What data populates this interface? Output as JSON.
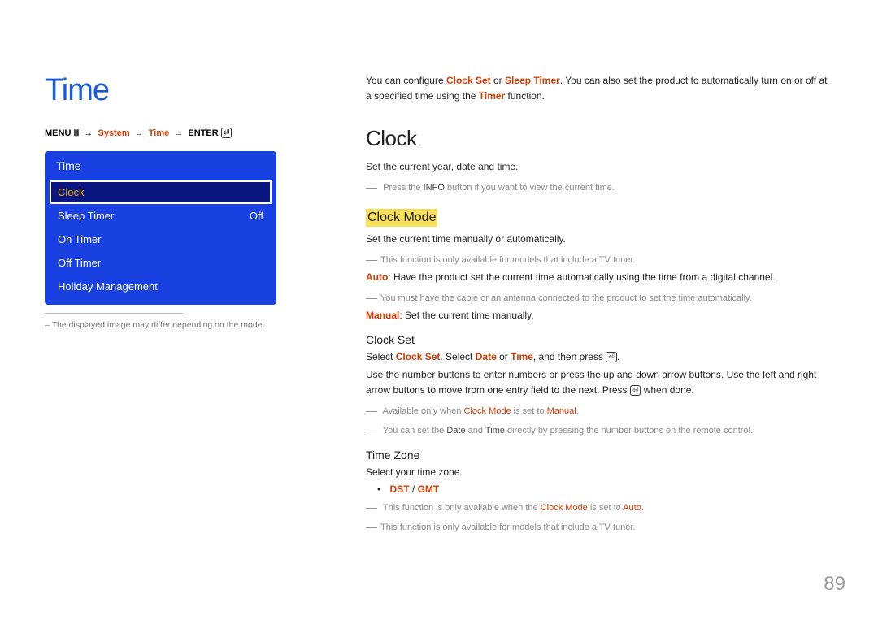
{
  "page": {
    "title": "Time",
    "number": "89"
  },
  "breadcrumb": {
    "menu_label": "MENU",
    "arrow": "→",
    "system": "System",
    "time": "Time",
    "enter": "ENTER"
  },
  "menu_card": {
    "title": "Time",
    "items": [
      {
        "label": "Clock",
        "value": "",
        "selected": true
      },
      {
        "label": "Sleep Timer",
        "value": "Off"
      },
      {
        "label": "On Timer",
        "value": ""
      },
      {
        "label": "Off Timer",
        "value": ""
      },
      {
        "label": "Holiday Management",
        "value": ""
      }
    ]
  },
  "footnote": "– The displayed image may differ depending on the model.",
  "intro": {
    "prefix": "You can configure ",
    "clock_set": "Clock Set",
    "or": " or ",
    "sleep_timer": "Sleep Timer",
    "after": ". You can also set the product to automatically turn on or off at a specified time using the ",
    "timer": "Timer",
    "suffix": " function."
  },
  "clock": {
    "heading": "Clock",
    "desc": "Set the current year, date and time.",
    "note_info_1": "Press the ",
    "note_info_bold": "INFO",
    "note_info_2": " button if you want to view the current time."
  },
  "clock_mode": {
    "heading": "Clock Mode",
    "desc": "Set the current time manually or automatically.",
    "note_tuner": "This function is only available for models that include a TV tuner.",
    "auto_label": "Auto",
    "auto_text": ": Have the product set the current time automatically using the time from a digital channel.",
    "auto_note": "You must have the cable or an antenna connected to the product to set the time automatically.",
    "manual_label": "Manual",
    "manual_text": ": Set the current time manually."
  },
  "clock_set": {
    "heading": "Clock Set",
    "line1_prefix": "Select ",
    "line1_cs": "Clock Set",
    "line1_mid": ". Select ",
    "line1_date": "Date",
    "line1_or": " or ",
    "line1_time": "Time",
    "line1_suffix": ", and then press ",
    "line1_end": ".",
    "line2_a": "Use the number buttons to enter numbers or press the up and down arrow buttons. Use the left and right arrow buttons to move from one entry field to the next. Press ",
    "line2_b": " when done.",
    "note_avail_1": "Available only when ",
    "note_avail_cm": "Clock Mode",
    "note_avail_2": " is set to ",
    "note_avail_manual": "Manual",
    "note_avail_3": ".",
    "note_remote_1": "You can set the ",
    "note_remote_date": "Date",
    "note_remote_and": " and ",
    "note_remote_time": "Time",
    "note_remote_2": " directly by pressing the number buttons on the remote control."
  },
  "time_zone": {
    "heading": "Time Zone",
    "desc": "Select your time zone.",
    "bullet_dst": "DST",
    "bullet_sep": " / ",
    "bullet_gmt": "GMT",
    "note_auto_1": "This function is only available when the ",
    "note_auto_cm": "Clock Mode",
    "note_auto_2": " is set to ",
    "note_auto_auto": "Auto",
    "note_auto_3": ".",
    "note_tuner": "This function is only available for models that include a TV tuner."
  }
}
